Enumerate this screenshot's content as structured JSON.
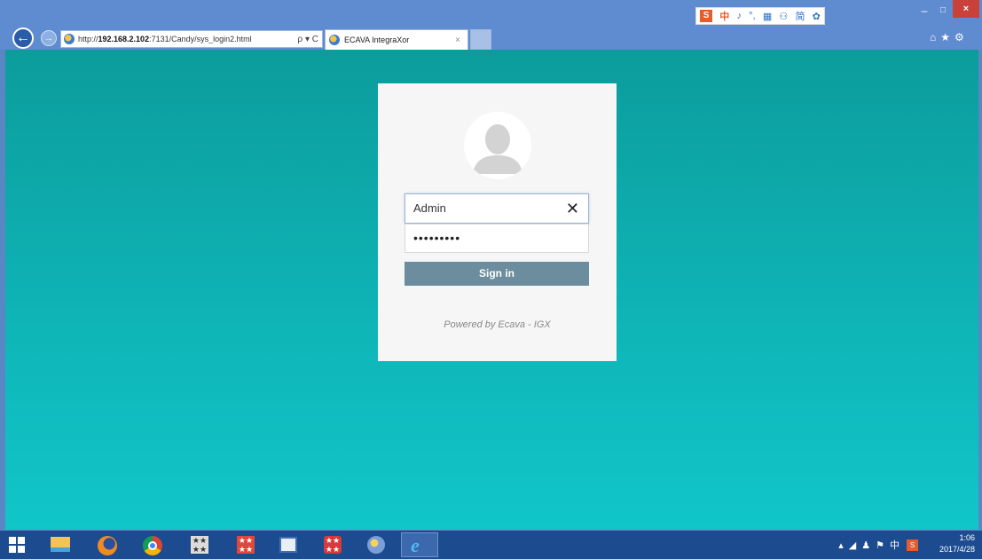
{
  "browser": {
    "url_prefix": "http://",
    "url_host": "192.168.2.102",
    "url_path": ":7131/Candy/sys_login2.html",
    "address_tools": "ρ ▾ C",
    "tab_title": "ECAVA IntegraXor",
    "tab_close": "×",
    "back_glyph": "←",
    "forward_glyph": "→",
    "tools_glyphs": "⌂★⚙",
    "window_controls": {
      "minimize": "–",
      "maximize": "□",
      "close": "×"
    }
  },
  "ime_toolbar": {
    "logo": "S",
    "mode": "中",
    "items": [
      "♪",
      "°,",
      "▦",
      "⚇",
      "简",
      "✿"
    ]
  },
  "login": {
    "username_value": "Admin",
    "clear_glyph": "✕",
    "password_masked": "•••••••••",
    "signin_label": "Sign in",
    "footer": "Powered by Ecava - IGX"
  },
  "taskbar": {
    "ie_glyph": "e",
    "app1_glyph": "★★ ★★",
    "app2_glyph": "★★ ★★",
    "app4_glyph": "★★ ★★",
    "tray": [
      "▴",
      "◢",
      "♟",
      "⚑",
      "中"
    ],
    "tray_sougou": "S",
    "clock_time": "1:06",
    "clock_date": "2017/4/28"
  },
  "colors": {
    "page_gradient_top": "#0c9c9c",
    "page_gradient_bottom": "#10c6c9",
    "signin_bg": "#6b8d9e",
    "taskbar": "#1d4b8f"
  }
}
